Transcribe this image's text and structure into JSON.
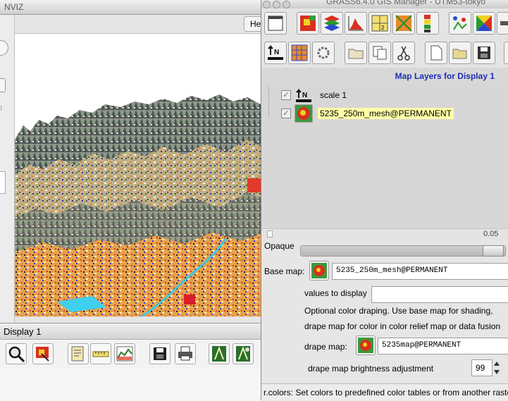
{
  "nviz": {
    "title": "NVIZ",
    "help_label": "He"
  },
  "display": {
    "title": "Display 1",
    "tools": [
      "zoom-icon",
      "query-icon",
      "overlay-icon",
      "measure-icon",
      "profile-icon",
      "save-icon",
      "print-icon",
      "nviz-icon",
      "nviz-settings-icon"
    ]
  },
  "gis": {
    "title": "GRASS6.4.0 GIS Manager - UTM53-tokyo",
    "toolbar_row1": [
      "map-display-icon",
      "raster-icon",
      "vector-layers-icon",
      "histogram-icon",
      "grid-icon",
      "rgb-icon",
      "legend-icon",
      "vector-points-icon",
      "shaded-icon",
      "more-icon"
    ],
    "toolbar_row2": [
      "scale-bar-icon",
      "grid-overlay-icon",
      "settings-icon",
      "group-icon",
      "copy-icon",
      "cut-icon",
      "new-icon",
      "open-icon",
      "save-icon"
    ],
    "layers_heading": "Map Layers for Display 1",
    "layers": [
      {
        "name": "scale 1",
        "checked": true,
        "icon": "scale-bar-icon",
        "selected": false
      },
      {
        "name": "5235_250m_mesh@PERMANENT",
        "checked": true,
        "icon": "raster-map-icon",
        "selected": true
      }
    ]
  },
  "props": {
    "opacity_label": "Opaque",
    "opacity_value": "0.05",
    "base_map_label": "Base map:",
    "base_map_value": "5235_250m_mesh@PERMANENT",
    "values_label": "values to display",
    "values_value": "",
    "drape_note_1": "Optional color draping. Use base map for shading,",
    "drape_note_2": "drape map for color in color relief map or data fusion",
    "drape_map_label": "drape map:",
    "drape_map_value": "5235map@PERMANENT",
    "brightness_label": "drape map brightness adjustment",
    "brightness_value": "99",
    "status": "r.colors: Set colors to predefined color tables or from another raste"
  },
  "colors": {
    "accent_blue": "#1e2fb0",
    "selected_row": "#ffffa8"
  }
}
